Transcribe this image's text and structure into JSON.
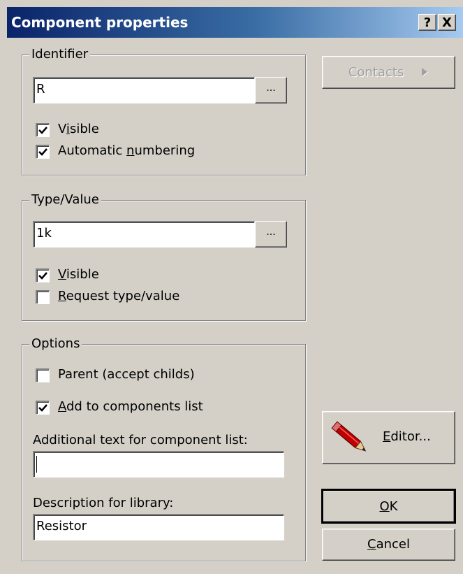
{
  "window": {
    "title": "Component properties",
    "help_button": "?",
    "close_button": "X"
  },
  "identifier": {
    "legend": "Identifier",
    "value": "R",
    "browse_label": "...",
    "visible": {
      "label_pre": "V",
      "label_u": "i",
      "label_post": "sible",
      "checked": true
    },
    "auto_numbering": {
      "label_pre": "Automatic ",
      "label_u": "n",
      "label_post": "umbering",
      "checked": true
    }
  },
  "type_value": {
    "legend": "Type/Value",
    "value": "1k",
    "browse_label": "...",
    "visible": {
      "label_pre": "",
      "label_u": "V",
      "label_post": "isible",
      "checked": true
    },
    "request": {
      "label_pre": "",
      "label_u": "R",
      "label_post": "equest type/value",
      "checked": false
    }
  },
  "options": {
    "legend": "Options",
    "parent": {
      "label": "Parent (accept childs)",
      "checked": false
    },
    "add_to_list": {
      "label_pre": "",
      "label_u": "A",
      "label_post": "dd to components list",
      "checked": true
    },
    "additional_text_label": "Additional text for component list:",
    "additional_text_value": "",
    "description_label": "Description for library:",
    "description_value": "Resistor"
  },
  "buttons": {
    "contacts": "Contacts",
    "editor_pre": "",
    "editor_u": "E",
    "editor_post": "ditor...",
    "ok_u": "O",
    "ok_post": "K",
    "cancel_u": "C",
    "cancel_post": "ancel"
  },
  "icons": {
    "editor": "pencil-icon",
    "contacts_arrow": "triangle-right-icon"
  },
  "colors": {
    "titlebar_start": "#0a246a",
    "titlebar_end": "#a6caf0",
    "face": "#d4d0c8"
  }
}
